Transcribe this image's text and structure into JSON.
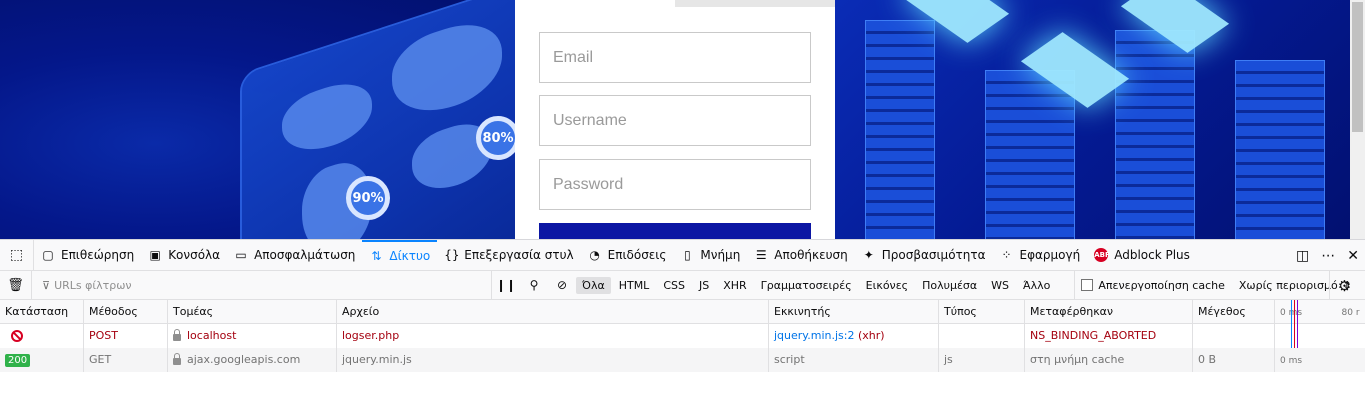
{
  "page": {
    "badges": [
      "90%",
      "80%"
    ],
    "form": {
      "email_placeholder": "Email",
      "username_placeholder": "Username",
      "password_placeholder": "Password"
    }
  },
  "devtools": {
    "tabs": [
      {
        "label": "Επιθεώρηση",
        "icon": "inspector-icon"
      },
      {
        "label": "Κονσόλα",
        "icon": "console-icon"
      },
      {
        "label": "Αποσφαλμάτωση",
        "icon": "debugger-icon"
      },
      {
        "label": "Δίκτυο",
        "icon": "network-icon",
        "selected": true
      },
      {
        "label": "Επεξεργασία στυλ",
        "icon": "style-editor-icon"
      },
      {
        "label": "Επιδόσεις",
        "icon": "performance-icon"
      },
      {
        "label": "Μνήμη",
        "icon": "memory-icon"
      },
      {
        "label": "Αποθήκευση",
        "icon": "storage-icon"
      },
      {
        "label": "Προσβασιμότητα",
        "icon": "accessibility-icon"
      },
      {
        "label": "Εφαρμογή",
        "icon": "application-icon"
      },
      {
        "label": "Adblock Plus",
        "icon": "adblock-icon"
      }
    ],
    "toolbar": {
      "filter_placeholder": "URLs φίλτρων",
      "type_filters": [
        "Όλα",
        "HTML",
        "CSS",
        "JS",
        "XHR",
        "Γραμματοσειρές",
        "Εικόνες",
        "Πολυμέσα",
        "WS",
        "Άλλο"
      ],
      "active_filter": "Όλα",
      "disable_cache_label": "Απενεργοποίηση cache",
      "throttle_label": "Χωρίς περιορισμό"
    },
    "columns": [
      "Κατάσταση",
      "Μέθοδος",
      "Τομέας",
      "Αρχείο",
      "Εκκινητής",
      "Τύπος",
      "Μεταφέρθηκαν",
      "Μέγεθος"
    ],
    "waterfall_ticks": [
      "0 ms",
      "80 r"
    ],
    "requests": [
      {
        "status": "",
        "status_icon": "blocked-icon",
        "method": "POST",
        "domain": "localhost",
        "file": "logser.php",
        "cause": "jquery.min.js:2",
        "cause_type": "(xhr)",
        "type": "",
        "transferred": "NS_BINDING_ABORTED",
        "size": "",
        "waterfall": ""
      },
      {
        "status": "200",
        "status_icon": "",
        "method": "GET",
        "domain": "ajax.googleapis.com",
        "file": "jquery.min.js",
        "cause": "script",
        "cause_type": "",
        "type": "js",
        "transferred": "στη μνήμη cache",
        "size": "0 B",
        "waterfall": "0 ms"
      }
    ],
    "colors": {
      "accent": "#0a84ff",
      "error": "#a4000f",
      "ok": "#30b24a"
    }
  }
}
